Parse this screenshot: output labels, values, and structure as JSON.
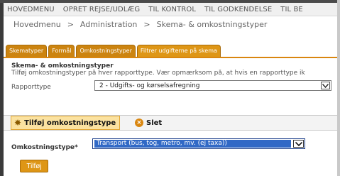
{
  "topnav": {
    "items": [
      "HOVEDMENU",
      "OPRET REJSE/UDLÆG",
      "TIL KONTROL",
      "TIL GODKENDELSE",
      "TIL BE"
    ]
  },
  "breadcrumb": {
    "items": [
      "Hovedmenu",
      "Administration",
      "Skema- & omkostningstyper"
    ],
    "separator": ">"
  },
  "tabs": [
    {
      "label": "Skematyper",
      "active": false
    },
    {
      "label": "Formål",
      "active": false
    },
    {
      "label": "Omkostningstyper",
      "active": false
    },
    {
      "label": "Filtrer udgifterne på skema",
      "active": true
    }
  ],
  "section": {
    "title": "Skema- & omkostningstyper",
    "description": "Tilføj omkostningstyper på hver rapporttype. Vær opmærksom på, at hvis en rapporttype ik"
  },
  "report_type": {
    "label": "Rapporttype",
    "selected": "2 - Udgifts- og kørselsafregning"
  },
  "actions": {
    "add_label": "Tilføj omkostningstype",
    "delete_label": "Slet"
  },
  "cost_type": {
    "label": "Omkostningstype*",
    "selected": "Transport (bus, tog, metro, mv. (ej taxa))"
  },
  "add_button": {
    "label": "Tilføj"
  },
  "colors": {
    "accent": "#de9616",
    "tab_active": "#de9616",
    "action_bg": "#fbe2a0",
    "selection": "#3169c6"
  }
}
